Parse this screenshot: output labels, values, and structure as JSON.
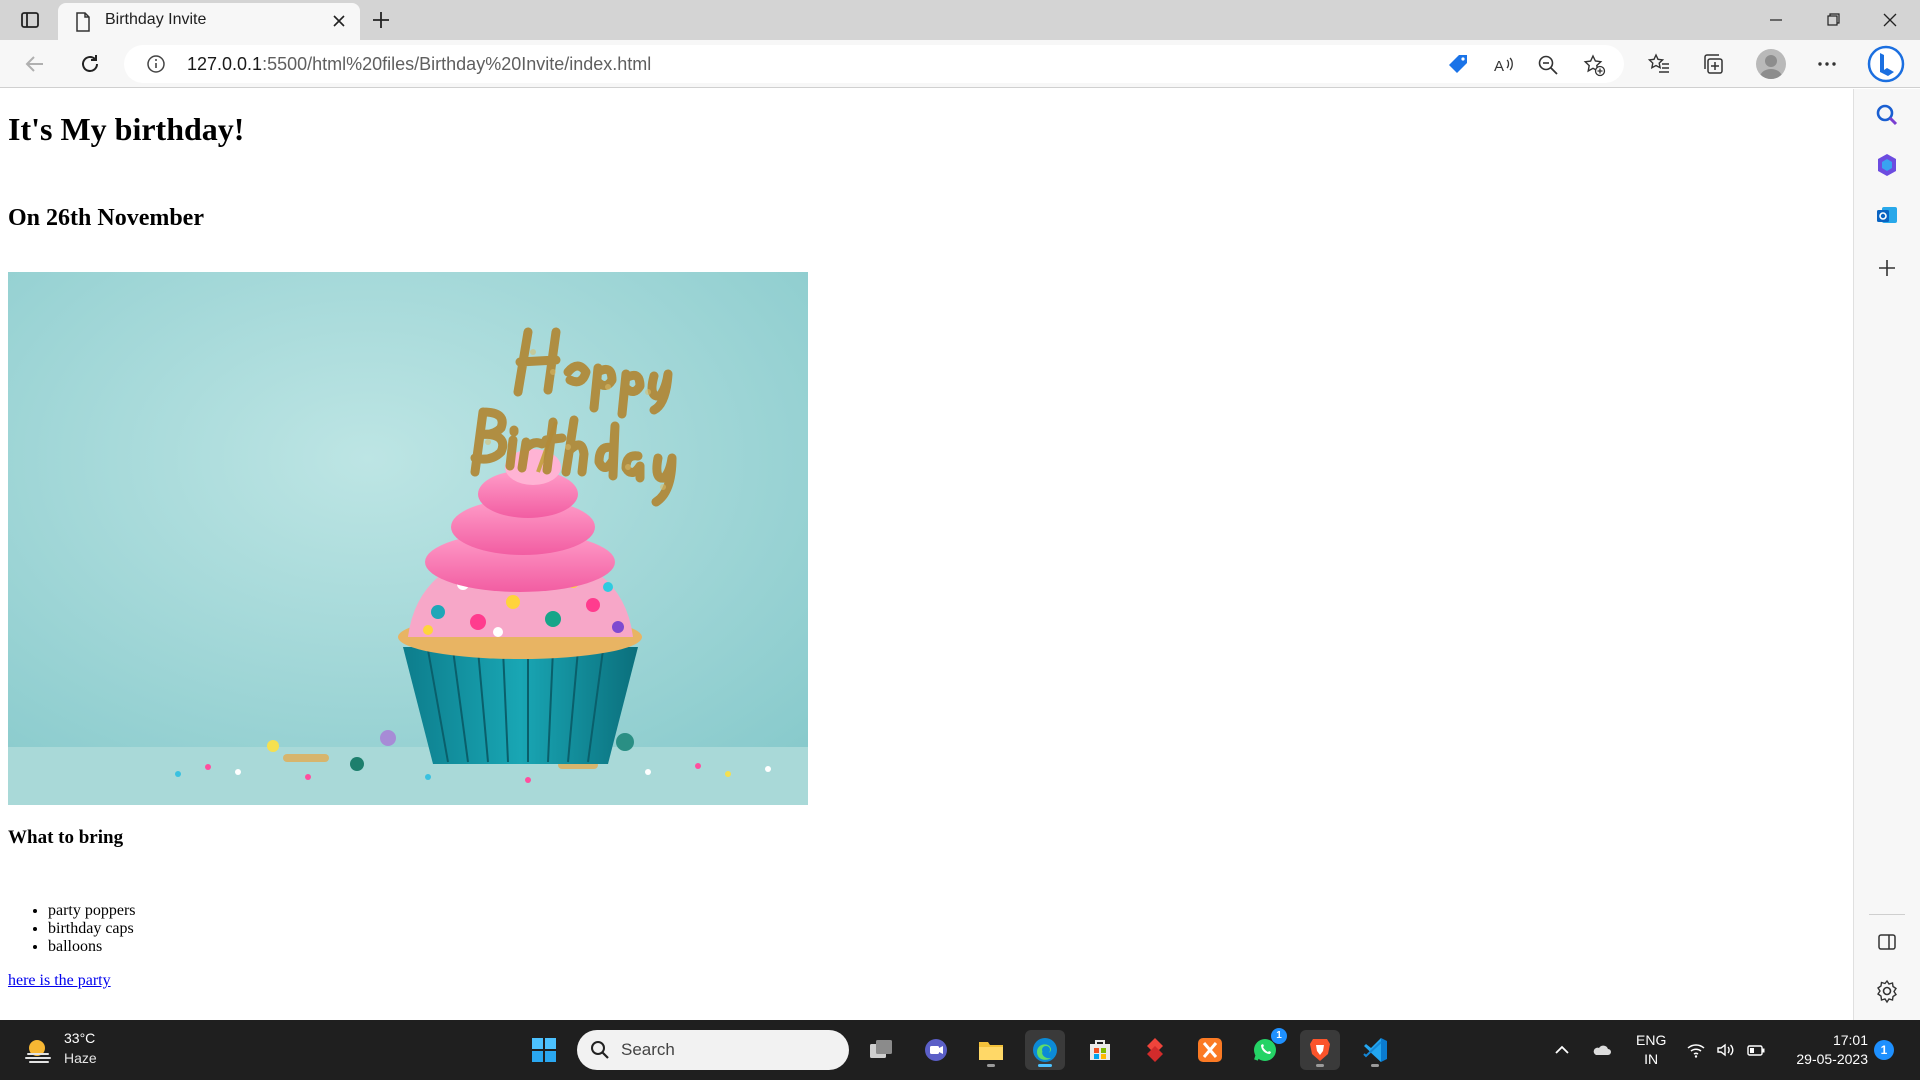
{
  "browser": {
    "tab_title": "Birthday Invite",
    "url_host": "127.0.0.1",
    "url_path": ":5500/html%20files/Birthday%20Invite/index.html"
  },
  "page": {
    "heading": "It's My birthday!",
    "subheading": "On 26th November",
    "image_alt": "Happy Birthday",
    "bring_heading": "What to bring",
    "bring_items": [
      "party poppers",
      "birthday caps",
      "balloons"
    ],
    "party_link": "here is the party"
  },
  "taskbar": {
    "weather_temp": "33°C",
    "weather_cond": "Haze",
    "search_placeholder": "Search",
    "lang_line1": "ENG",
    "lang_line2": "IN",
    "time": "17:01",
    "date": "29-05-2023",
    "notification_count": "1",
    "whatsapp_badge": "1"
  },
  "colors": {
    "accent": "#0078d4",
    "link": "#0000ee",
    "taskbar": "#1f1f1f"
  }
}
